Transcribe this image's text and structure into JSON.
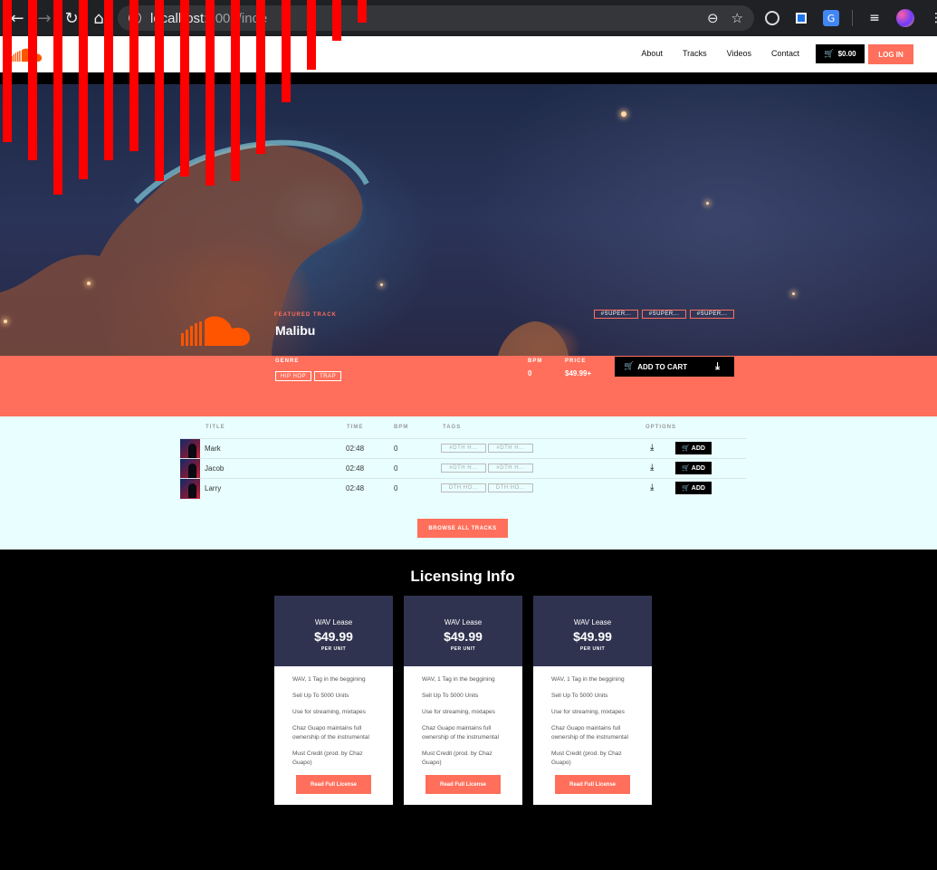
{
  "browser": {
    "url_host": "localhost:",
    "url_rest": "8000/inde",
    "icons": [
      "back-icon",
      "forward-icon",
      "reload-icon",
      "home-icon",
      "zoom-icon",
      "star-icon"
    ]
  },
  "header": {
    "nav": [
      "About",
      "Tracks",
      "Videos",
      "Contact"
    ],
    "cart_total": "$0.00",
    "login_label": "LOG IN"
  },
  "featured": {
    "label": "FEATURED TRACK",
    "title": "Malibu",
    "tags": [
      "#SUPER...",
      "#SUPER...",
      "#SUPER..."
    ],
    "genre_label": "GENRE",
    "genres": [
      "HIP HOP",
      "TRAP"
    ],
    "bpm_label": "BPM",
    "bpm": "0",
    "price_label": "PRICE",
    "price": "$49.99+",
    "add_to_cart_label": "ADD TO CART"
  },
  "tracks": {
    "columns": [
      "TITLE",
      "TIME",
      "BPM",
      "TAGS",
      "OPTIONS"
    ],
    "rows": [
      {
        "title": "Mark",
        "time": "02:48",
        "bpm": "0",
        "tags": [
          "#DTH H...",
          "#DTH H..."
        ],
        "add_label": "ADD"
      },
      {
        "title": "Jacob",
        "time": "02:48",
        "bpm": "0",
        "tags": [
          "#DTH H...",
          "#DTH H..."
        ],
        "add_label": "ADD"
      },
      {
        "title": "Larry",
        "time": "02:48",
        "bpm": "0",
        "tags": [
          "DTH HO...",
          "DTH HO..."
        ],
        "add_label": "ADD"
      }
    ],
    "browse_label": "BROWSE ALL TRACKS"
  },
  "licensing": {
    "title": "Licensing Info",
    "cards": [
      {
        "name": "WAV Lease",
        "price": "$49.99",
        "unit": "PER UNIT",
        "features": [
          "WAV, 1 Tag in the beggining",
          "Sell Up To 5000 Units",
          "Use for streaming, mixtapes",
          "Chaz Guapo maintains full ownership of the instrumental",
          "Must Credit (prod. by Chaz Guapo)"
        ],
        "button": "Read Full License"
      },
      {
        "name": "WAV Lease",
        "price": "$49.99",
        "unit": "PER UNIT",
        "features": [
          "WAV, 1 Tag in the beggining",
          "Sell Up To 5000 Units",
          "Use for streaming, mixtapes",
          "Chaz Guapo maintains full ownership of the instrumental",
          "Must Credit (prod. by Chaz Guapo)"
        ],
        "button": "Read Full License"
      },
      {
        "name": "WAV Lease",
        "price": "$49.99",
        "unit": "PER UNIT",
        "features": [
          "WAV, 1 Tag in the beggining",
          "Sell Up To 5000 Units",
          "Use for streaming, mixtapes",
          "Chaz Guapo maintains full ownership of the instrumental",
          "Must Credit (prod. by Chaz Guapo)"
        ],
        "button": "Read Full License"
      }
    ]
  },
  "colors": {
    "accent": "#ff6f5b",
    "card_header": "#2f334f",
    "tracks_bg": "#e9ffff",
    "overlay_red": "#ff0000"
  }
}
